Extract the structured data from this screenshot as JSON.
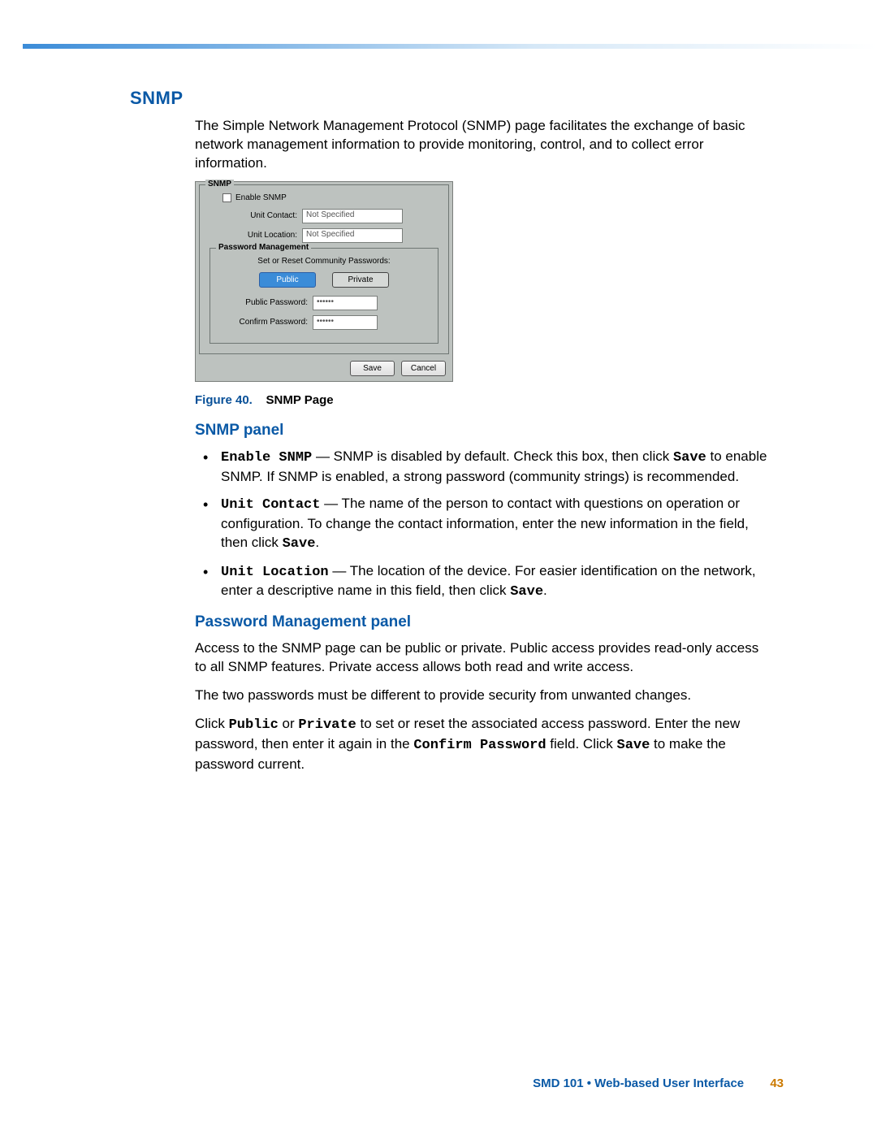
{
  "heading_snmp": "SNMP",
  "intro": "The Simple Network Management Protocol (SNMP) page facilitates the exchange of basic network management information to provide monitoring, control, and to collect error information.",
  "figure": {
    "legend_snmp": "SNMP",
    "enable_snmp": "Enable SNMP",
    "unit_contact_label": "Unit Contact:",
    "unit_contact_value": "Not Specified",
    "unit_location_label": "Unit Location:",
    "unit_location_value": "Not Specified",
    "legend_pwmgmt": "Password Management",
    "pw_instruction": "Set or Reset Community Passwords:",
    "public_btn": "Public",
    "private_btn": "Private",
    "public_pw_label": "Public Password:",
    "public_pw_value": "••••••",
    "confirm_pw_label": "Confirm Password:",
    "confirm_pw_value": "••••••",
    "save_btn": "Save",
    "cancel_btn": "Cancel"
  },
  "caption_fig": "Figure 40.",
  "caption_text": "SNMP Page",
  "h3_snmp_panel": "SNMP panel",
  "bullets": {
    "b1_term": "Enable SNMP",
    "b1_text_a": " — SNMP is disabled by default. Check this box, then click ",
    "b1_save": "Save",
    "b1_text_b": " to enable SNMP. If SNMP is enabled, a strong password (community strings) is recommended.",
    "b2_term": "Unit Contact",
    "b2_text_a": " — The name of the person to contact with questions on operation or configuration. To change the contact information, enter the new information in the field, then click ",
    "b2_save": "Save",
    "b2_text_b": ".",
    "b3_term": "Unit Location",
    "b3_text_a": " — The location of the device. For easier identification on the network, enter a descriptive name in this field, then click ",
    "b3_save": "Save",
    "b3_text_b": "."
  },
  "h3_pwmgmt": "Password Management panel",
  "pw_para1": "Access to the SNMP page can be public or private. Public access provides read-only access to all SNMP features. Private access allows both read and write access.",
  "pw_para2": "The two passwords must be different to provide security from unwanted changes.",
  "pw_para3_a": "Click ",
  "pw_para3_public": "Public",
  "pw_para3_or": " or ",
  "pw_para3_private": "Private",
  "pw_para3_b": " to set or reset the associated access password. Enter the new password, then enter it again in the ",
  "pw_para3_confirm": "Confirm Password",
  "pw_para3_c": " field. Click ",
  "pw_para3_save": "Save",
  "pw_para3_d": " to make the password current.",
  "footer_text": "SMD 101 • Web-based User Interface",
  "footer_page": "43"
}
